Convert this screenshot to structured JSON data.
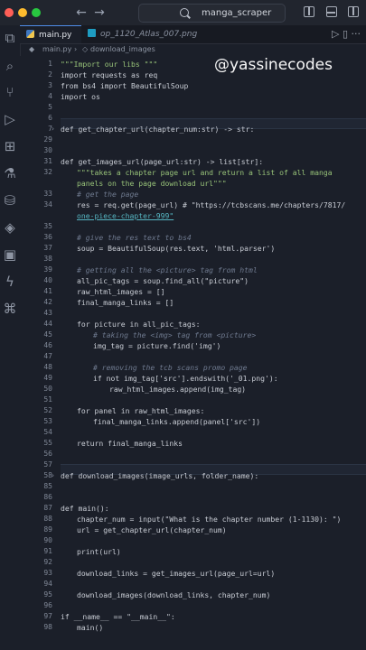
{
  "window": {
    "search_text": "manga_scraper"
  },
  "tabs": [
    {
      "label": "main.py"
    },
    {
      "label": "op_1120_Atlas_007.png"
    }
  ],
  "breadcrumb": {
    "file": "main.py",
    "symbol": "download_images"
  },
  "watermark": "@yassinecodes",
  "code_lines": [
    {
      "number": "1",
      "text": "\"\"\"Import our libs \"\"\""
    },
    {
      "number": "2",
      "text": "import requests as req"
    },
    {
      "number": "3",
      "text": "from bs4 import BeautifulSoup"
    },
    {
      "number": "4",
      "text": "import os"
    },
    {
      "number": "5",
      "text": ""
    },
    {
      "number": "6",
      "text": ""
    },
    {
      "number": "7",
      "text": "def get_chapter_url(chapter_num:str) -> str:"
    },
    {
      "number": "29",
      "text": ""
    },
    {
      "number": "30",
      "text": ""
    },
    {
      "number": "31",
      "text": "def get_images_url(page_url:str) -> list[str]:"
    },
    {
      "number": "32",
      "text": "\"\"\"takes a chapter page url and return a list of all manga"
    },
    {
      "number": "",
      "text": "panels on the page download url\"\"\""
    },
    {
      "number": "33",
      "text": "# get the page"
    },
    {
      "number": "34",
      "text": "res = req.get(page_url) # \"https://tcbscans.me/chapters/7817/"
    },
    {
      "number": "",
      "text": "one-piece-chapter-999\""
    },
    {
      "number": "35",
      "text": ""
    },
    {
      "number": "36",
      "text": "# give the res text to bs4"
    },
    {
      "number": "37",
      "text": "soup = BeautifulSoup(res.text, 'html.parser')"
    },
    {
      "number": "38",
      "text": ""
    },
    {
      "number": "39",
      "text": "# getting all the <picture> tag from html"
    },
    {
      "number": "40",
      "text": "all_pic_tags = soup.find_all(\"picture\")"
    },
    {
      "number": "41",
      "text": "raw_html_images = []"
    },
    {
      "number": "42",
      "text": "final_manga_links = []"
    },
    {
      "number": "43",
      "text": ""
    },
    {
      "number": "44",
      "text": "for picture in all_pic_tags:"
    },
    {
      "number": "45",
      "text": "# taking the <img> tag from <picture>"
    },
    {
      "number": "46",
      "text": "img_tag = picture.find('img')"
    },
    {
      "number": "47",
      "text": ""
    },
    {
      "number": "48",
      "text": "# removing the tcb scans promo page"
    },
    {
      "number": "49",
      "text": "if not img_tag['src'].endswith('_01.png'):"
    },
    {
      "number": "50",
      "text": "raw_html_images.append(img_tag)"
    },
    {
      "number": "51",
      "text": ""
    },
    {
      "number": "52",
      "text": "for panel in raw_html_images:"
    },
    {
      "number": "53",
      "text": "final_manga_links.append(panel['src'])"
    },
    {
      "number": "54",
      "text": ""
    },
    {
      "number": "55",
      "text": "return final_manga_links"
    },
    {
      "number": "56",
      "text": ""
    },
    {
      "number": "57",
      "text": ""
    },
    {
      "number": "58",
      "text": "def download_images(image_urls, folder_name):"
    },
    {
      "number": "85",
      "text": ""
    },
    {
      "number": "86",
      "text": ""
    },
    {
      "number": "87",
      "text": "def main():"
    },
    {
      "number": "88",
      "text": "chapter_num = input(\"What is the chapter number (1-1130): \")"
    },
    {
      "number": "89",
      "text": "url = get_chapter_url(chapter_num)"
    },
    {
      "number": "90",
      "text": ""
    },
    {
      "number": "91",
      "text": "print(url)"
    },
    {
      "number": "92",
      "text": ""
    },
    {
      "number": "93",
      "text": "download_links = get_images_url(page_url=url)"
    },
    {
      "number": "94",
      "text": ""
    },
    {
      "number": "95",
      "text": "download_images(download_links, chapter_num)"
    },
    {
      "number": "96",
      "text": ""
    },
    {
      "number": "97",
      "text": "if __name__ == \"__main__\":"
    },
    {
      "number": "98",
      "text": "main()"
    }
  ],
  "icons": {
    "nav_back": "←",
    "nav_forward": "→",
    "run": "▷",
    "more": "···",
    "fold": "›"
  }
}
